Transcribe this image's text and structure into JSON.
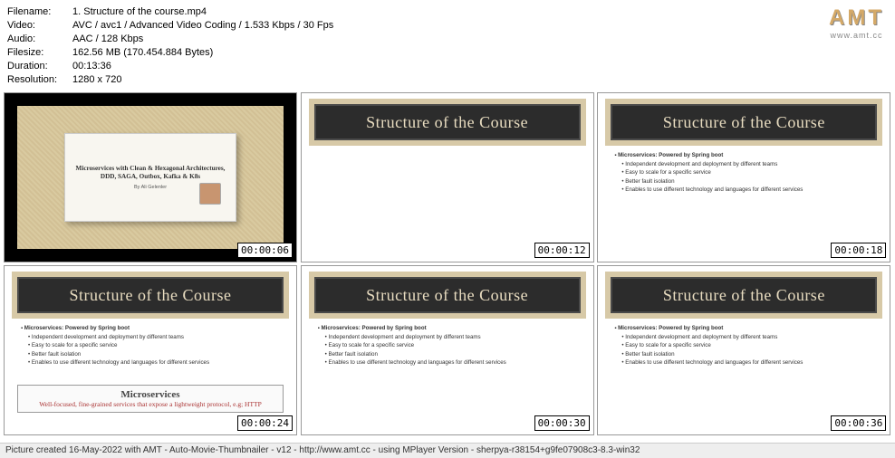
{
  "meta": {
    "filename_label": "Filename:",
    "filename": "1. Structure of the course.mp4",
    "video_label": "Video:",
    "video": "AVC / avc1 / Advanced Video Coding / 1.533 Kbps / 30 Fps",
    "audio_label": "Audio:",
    "audio": "AAC / 128 Kbps",
    "filesize_label": "Filesize:",
    "filesize": "162.56 MB (170.454.884 Bytes)",
    "duration_label": "Duration:",
    "duration": "00:13:36",
    "resolution_label": "Resolution:",
    "resolution": "1280 x 720"
  },
  "logo": {
    "text": "AMT",
    "url": "www.amt.cc"
  },
  "thumbs": [
    {
      "type": "intro",
      "plaque_title": "Microservices with Clean & Hexagonal Architectures, DDD, SAGA, Outbox, Kafka & K8s",
      "plaque_by": "By Ali Gelenler",
      "timestamp": "00:00:06"
    },
    {
      "type": "slide_empty",
      "timestamp": "00:00:12"
    },
    {
      "type": "slide_bullets",
      "timestamp": "00:00:18"
    },
    {
      "type": "slide_callout",
      "timestamp": "00:00:24"
    },
    {
      "type": "slide_bullets",
      "timestamp": "00:00:30"
    },
    {
      "type": "slide_bullets",
      "timestamp": "00:00:36"
    }
  ],
  "slide": {
    "header": "Structure of the Course",
    "bullets": {
      "b1": "Microservices: Powered by Spring boot",
      "b2a": "Independent development and deployment by different teams",
      "b2b": "Easy to scale for a specific service",
      "b2c": "Better fault isolation",
      "b2d": "Enables to use different technology and languages for different services"
    }
  },
  "callout": {
    "title": "Microservices",
    "sub": "Well-focused, fine-grained services that expose a lightweight protocol, e.g; HTTP"
  },
  "footer": "Picture created 16-May-2022 with AMT - Auto-Movie-Thumbnailer - v12 - http://www.amt.cc - using MPlayer Version - sherpya-r38154+g9fe07908c3-8.3-win32"
}
